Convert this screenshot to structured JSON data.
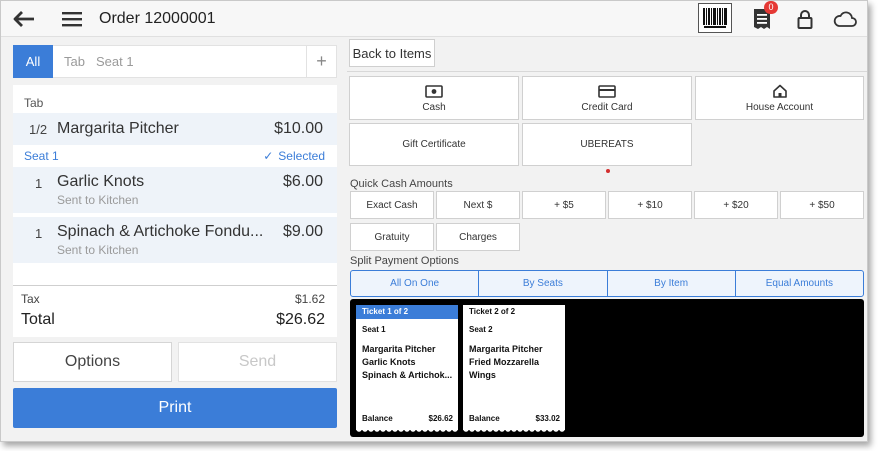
{
  "header": {
    "title": "Order 12000001",
    "receipt_badge": "0"
  },
  "left": {
    "tabs": {
      "all": "All",
      "tab": "Tab",
      "seat1": "Seat 1",
      "add": "+"
    },
    "tab_section_label": "Tab",
    "seat_label": "Seat 1",
    "seat_status": "Selected",
    "items": [
      {
        "qty": "1/2",
        "name": "Margarita Pitcher",
        "price": "$10.00",
        "note": ""
      },
      {
        "qty": "1",
        "name": "Garlic Knots",
        "price": "$6.00",
        "note": "Sent to Kitchen"
      },
      {
        "qty": "1",
        "name": "Spinach & Artichoke Fondu...",
        "price": "$9.00",
        "note": "Sent to Kitchen"
      }
    ],
    "tax_label": "Tax",
    "tax_value": "$1.62",
    "total_label": "Total",
    "total_value": "$26.62",
    "options_label": "Options",
    "send_label": "Send",
    "print_label": "Print"
  },
  "right": {
    "back_label": "Back to Items",
    "payment_types": [
      {
        "label": "Cash",
        "icon": "cash-icon"
      },
      {
        "label": "Credit Card",
        "icon": "credit-card-icon"
      },
      {
        "label": "House Account",
        "icon": "house-icon"
      },
      {
        "label": "Gift Certificate",
        "icon": ""
      },
      {
        "label": "UBEREATS",
        "icon": ""
      }
    ],
    "quick_cash_label": "Quick Cash Amounts",
    "quick_cash": [
      "Exact Cash",
      "Next $",
      "+ $5",
      "+ $10",
      "+ $20",
      "+ $50"
    ],
    "extras": [
      "Gratuity",
      "Charges"
    ],
    "split_label": "Split Payment Options",
    "split_options": [
      "All On One",
      "By Seats",
      "By Item",
      "Equal Amounts"
    ],
    "tickets": [
      {
        "header": "Ticket 1 of 2",
        "seat": "Seat 1",
        "items": [
          "Margarita Pitcher",
          "Garlic Knots",
          "Spinach & Artichok..."
        ],
        "balance_label": "Balance",
        "balance": "$26.62"
      },
      {
        "header": "Ticket 2 of 2",
        "seat": "Seat 2",
        "items": [
          "Margarita Pitcher",
          "Fried Mozzarella",
          "Wings"
        ],
        "balance_label": "Balance",
        "balance": "$33.02"
      }
    ]
  },
  "colors": {
    "accent": "#3b7dd8",
    "badge": "#e53935"
  }
}
